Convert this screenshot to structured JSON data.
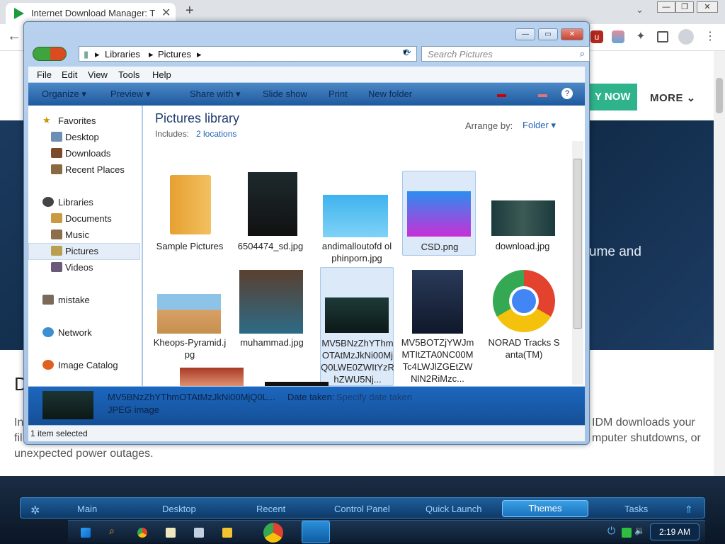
{
  "browser": {
    "tab_title": "Internet Download Manager: The fastest download accelerator",
    "new_tab": "+",
    "back": "←",
    "tab_menu": "⌄"
  },
  "page": {
    "buy_now": "Y NOW",
    "more": "MORE",
    "hero_text": "ume and",
    "heading_letter": "D",
    "para_lines": [
      {
        "left": "In",
        "right": "IDM downloads your"
      },
      {
        "left": "fil",
        "right": "mputer shutdowns, or"
      },
      {
        "left": "unexpected power outages.",
        "right": ""
      }
    ]
  },
  "explorer": {
    "breadcrumb": [
      "Libraries",
      "Pictures"
    ],
    "search_placeholder": "Search Pictures",
    "menus": [
      "File",
      "Edit",
      "View",
      "Tools",
      "Help"
    ],
    "commands": [
      "Organize ▾",
      "Preview ▾",
      "Share with ▾",
      "Slide show",
      "Print",
      "New folder"
    ],
    "nav": {
      "favorites": "Favorites",
      "desktop": "Desktop",
      "downloads": "Downloads",
      "recent": "Recent Places",
      "libraries": "Libraries",
      "documents": "Documents",
      "music": "Music",
      "pictures": "Pictures",
      "videos": "Videos",
      "mistake": "mistake",
      "network": "Network",
      "catalog": "Image Catalog"
    },
    "library_title": "Pictures library",
    "includes_label": "Includes:",
    "locations": "2 locations",
    "arrange_label": "Arrange by:",
    "arrange_value": "Folder ▾",
    "tiles": [
      {
        "label": "Sample Pictures"
      },
      {
        "label": "6504474_sd.jpg"
      },
      {
        "label": "andimalloutofd olphinporn.jpg"
      },
      {
        "label": "CSD.png"
      },
      {
        "label": "download.jpg"
      },
      {
        "label": "Kheops-Pyramid.jpg"
      },
      {
        "label": "muhammad.jpg"
      },
      {
        "label": "MV5BNzZhYThmOTAtMzJkNi00MjQ0LWE0ZWItYzRhZWU5Nj..."
      },
      {
        "label": "MV5BOTZjYWJmMTItZTA0NC00MTc4LWJlZGEtZWNlN2RiMzc..."
      },
      {
        "label": "NORAD Tracks Santa(TM)"
      }
    ],
    "details_name": "MV5BNzZhYThmOTAtMzJkNi00MjQ0L...",
    "details_label": "Date taken:",
    "details_value": "Specify date taken",
    "details_type": "JPEG image",
    "status": "1 item selected"
  },
  "taskbar": {
    "launch": [
      "Main",
      "Desktop",
      "Recent",
      "Control Panel",
      "Quick Launch",
      "Themes",
      "Tasks"
    ],
    "clock": "2:19 AM"
  }
}
